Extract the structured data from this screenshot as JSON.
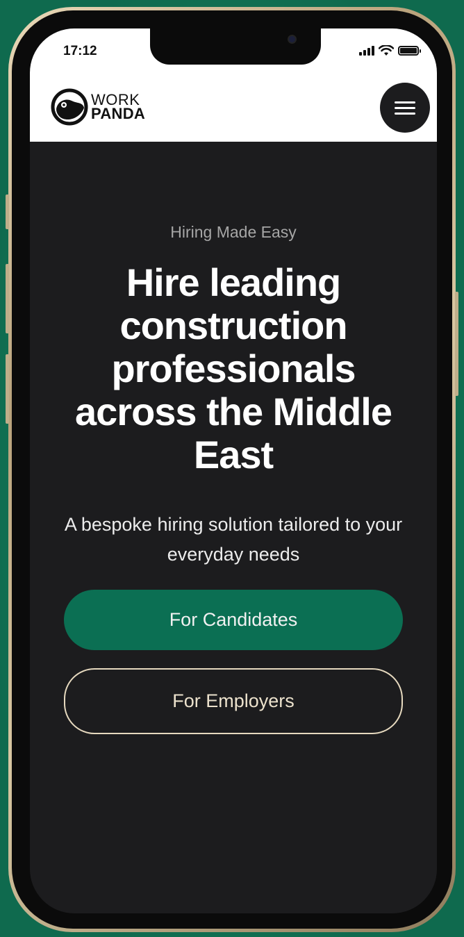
{
  "status_bar": {
    "time": "17:12"
  },
  "brand": {
    "line1": "WORK",
    "line2": "PANDA"
  },
  "hero": {
    "eyebrow": "Hiring Made Easy",
    "headline": "Hire leading construction professionals across the Middle East",
    "subtext": "A bespoke hiring solution tailored to your everyday needs",
    "primary_button": "For Candidates",
    "secondary_button": "For Employers"
  },
  "colors": {
    "accent_green": "#0b6f53",
    "screen_dark": "#1c1c1e",
    "outline_cream": "#e6d9bf"
  },
  "icons": {
    "menu": "hamburger-menu-icon",
    "logo": "panda-logo-icon",
    "wifi": "wifi-icon",
    "signal": "cellular-signal-icon",
    "battery": "battery-icon"
  }
}
